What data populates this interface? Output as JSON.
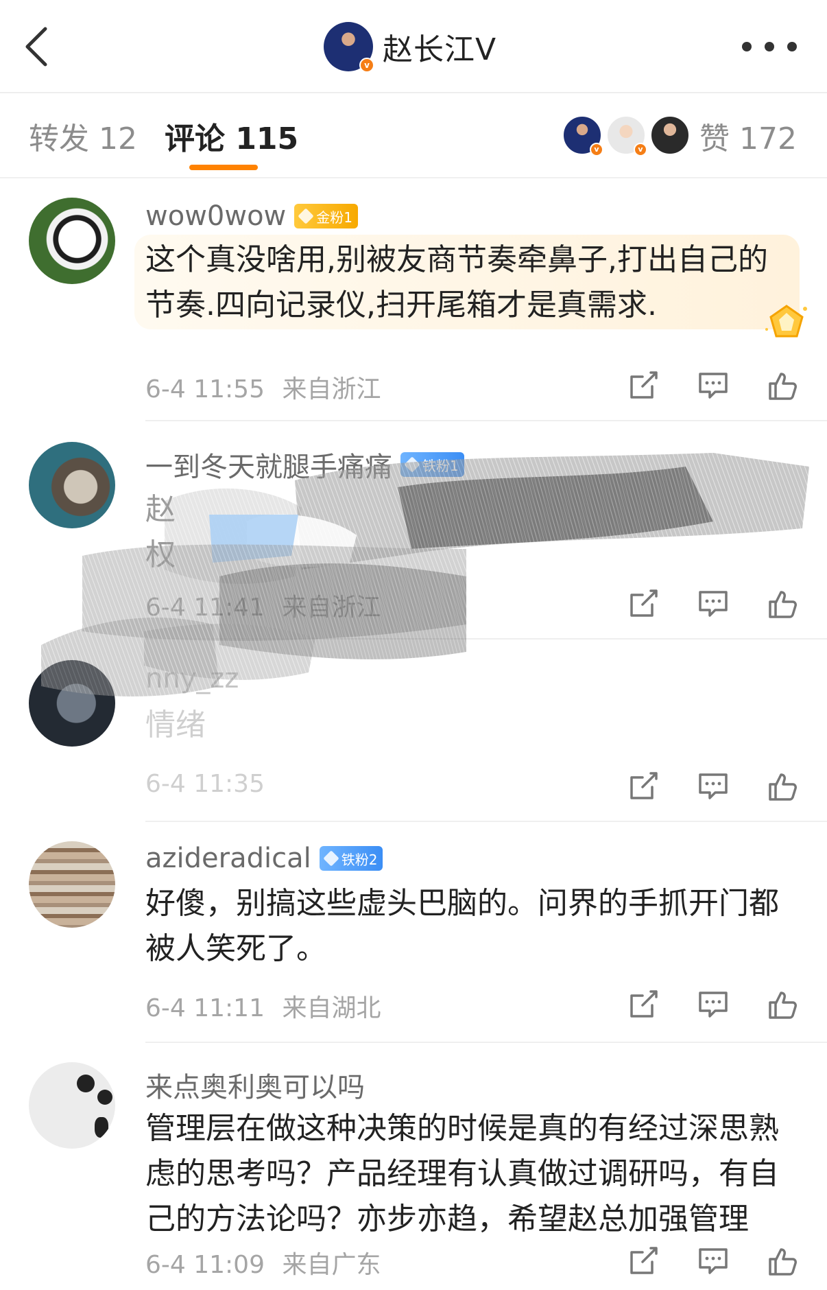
{
  "header": {
    "back_icon": "chevron-left-icon",
    "title": "赵长江V",
    "more_icon": "more-dots-icon"
  },
  "tabs": {
    "repost": "转发 12",
    "comment": "评论 115",
    "likes": "赞 172",
    "accent": "#ff8200"
  },
  "comments": [
    {
      "username": "wow0wow",
      "badge": "金粉1",
      "text_line1": "这个真没啥用,别被友商节奏牵鼻子,打出自己的",
      "text_line2": "节奏.四向记录仪,扫开尾箱才是真需求.",
      "date": "6-4 11:55",
      "location": "来自浙江"
    },
    {
      "username": "一到冬天就腿手痛痛",
      "badge": "铁粉1",
      "text_line1": "赵",
      "text_line2": "权",
      "date": "6-4 11:41",
      "location": "来自浙江"
    },
    {
      "username": "nny_zz",
      "text_line1": "情绪",
      "date": "6-4 11:35",
      "location": ""
    },
    {
      "username": "azideradical",
      "badge": "铁粉2",
      "text_line1": "好傻，别搞这些虚头巴脑的。问界的手抓开门都",
      "text_line2": "被人笑死了。",
      "date": "6-4 11:11",
      "location": "来自湖北"
    },
    {
      "username": "来点奥利奥可以吗",
      "text_line1": "管理层在做这种决策的时候是真的有经过深思熟",
      "text_line2": "虑的思考吗？产品经理有认真做过调研吗，有自",
      "text_line3": "己的方法论吗？亦步亦趋，希望赵总加强管理",
      "date": "6-4 11:09",
      "location": "来自广东"
    }
  ],
  "action_icons": [
    "share-icon",
    "comment-icon",
    "like-icon"
  ]
}
